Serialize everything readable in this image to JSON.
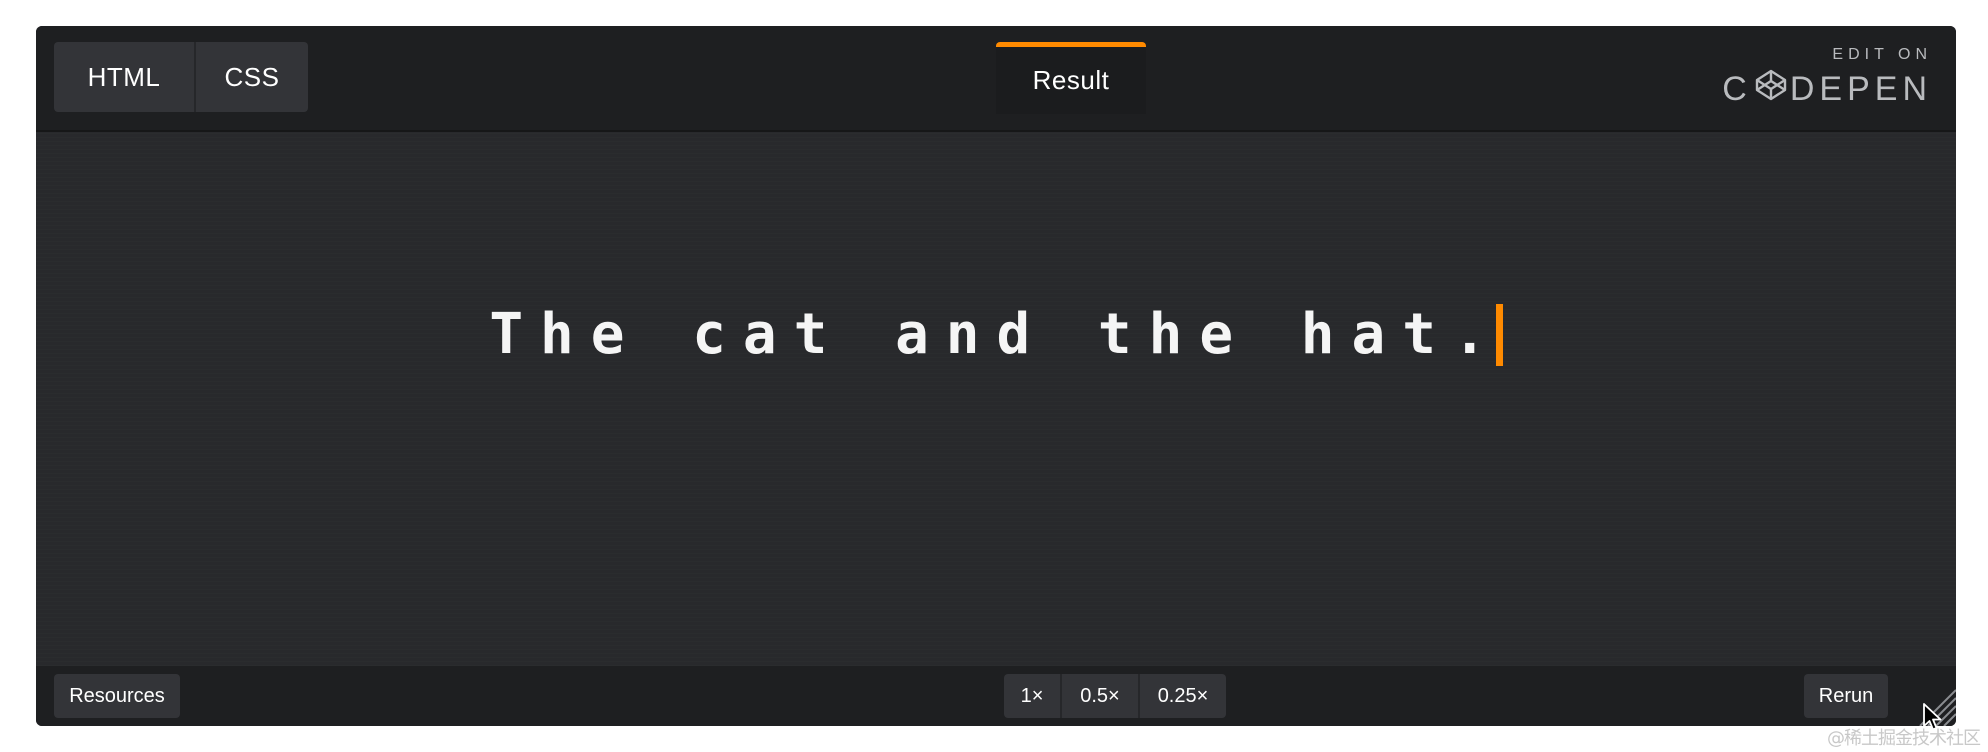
{
  "header": {
    "code_tabs": [
      "HTML",
      "CSS"
    ],
    "result_tab": "Result",
    "edit_on_label": "EDIT ON",
    "codepen_prefix": "C",
    "codepen_suffix": "DEPEN"
  },
  "result": {
    "text": "The cat and the hat."
  },
  "footer": {
    "resources_label": "Resources",
    "zoom_options": [
      "1×",
      "0.5×",
      "0.25×"
    ],
    "rerun_label": "Rerun"
  },
  "watermark": "@稀土掘金技术社区",
  "colors": {
    "accent": "#ff8a00",
    "panel": "#1e1f21",
    "result_bg": "#28292c",
    "button": "#333438"
  },
  "icons": {
    "codepen_logo": "codepen-cube-icon",
    "resize": "resize-handle-icon",
    "cursor": "mouse-pointer-icon"
  }
}
